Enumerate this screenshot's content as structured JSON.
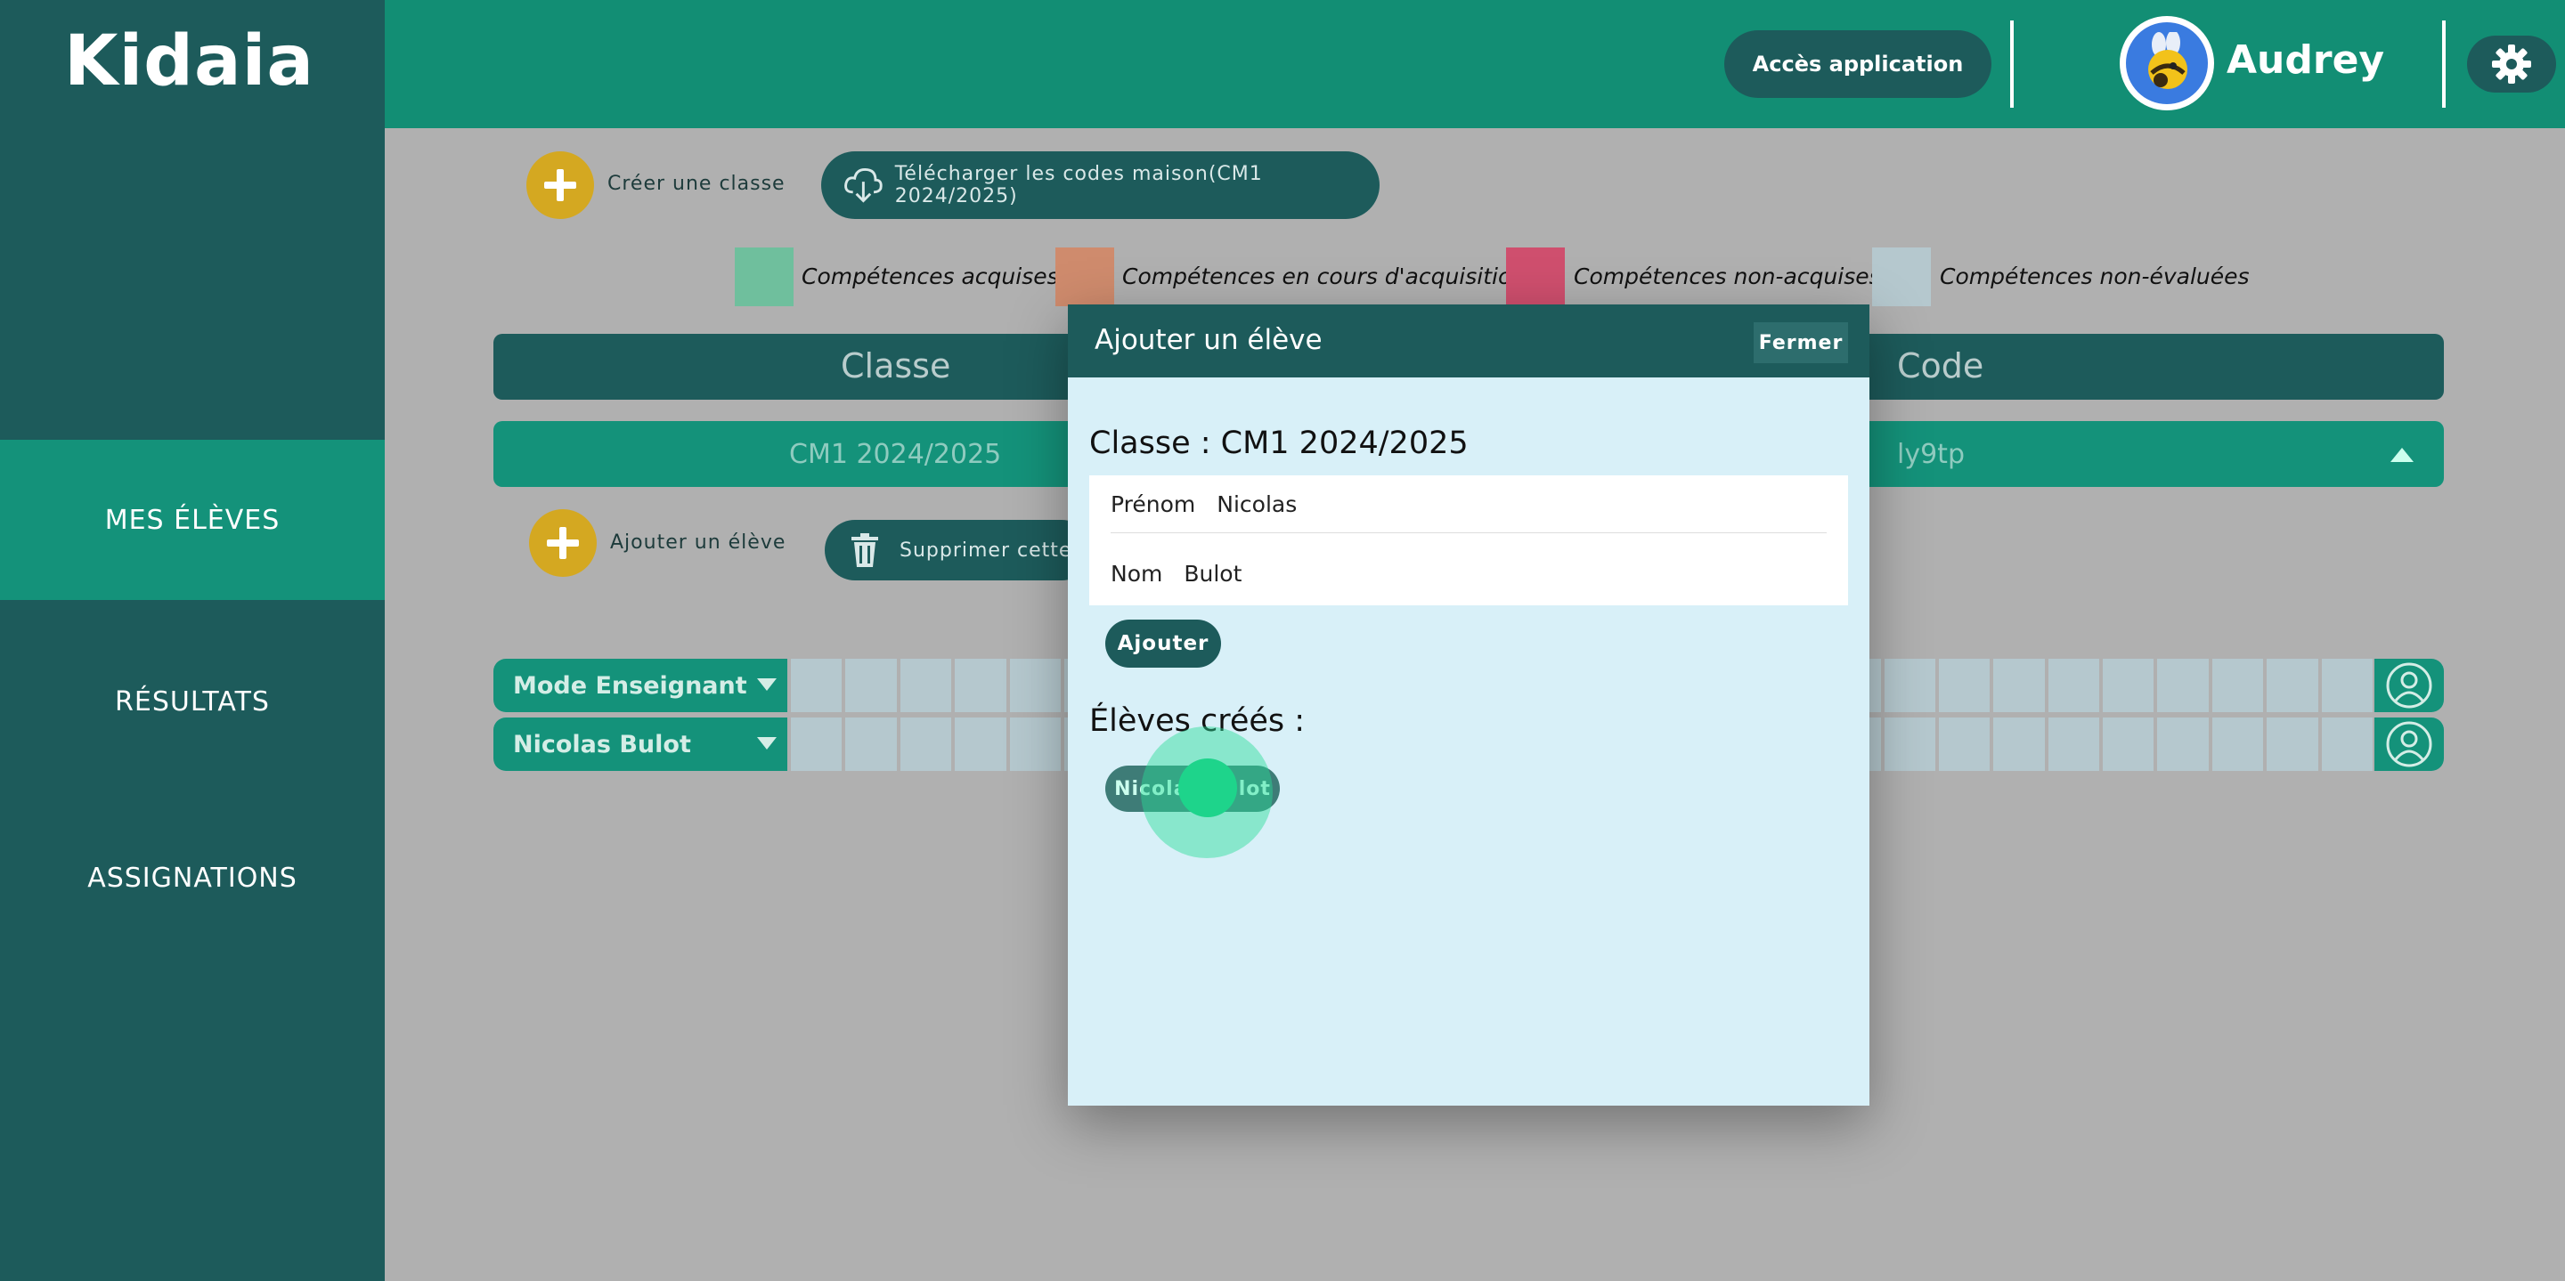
{
  "app": {
    "logo": "Kidaia"
  },
  "sidebar": {
    "items": [
      {
        "label": "MES ÉLÈVES",
        "active": true
      },
      {
        "label": "RÉSULTATS",
        "active": false
      },
      {
        "label": "ASSIGNATIONS",
        "active": false
      }
    ]
  },
  "header": {
    "app_access_label": "Accès application",
    "username": "Audrey",
    "avatar_icon": "bee-avatar-icon",
    "settings_icon": "gear-icon"
  },
  "toolbar": {
    "create_class_label": "Créer une classe",
    "download_codes_label": "Télécharger les codes maison(CM1 2024/2025)"
  },
  "legend": [
    {
      "label": "Compétences acquises",
      "color": "#6fbf9d"
    },
    {
      "label": "Compétences en cours d'acquisition",
      "color": "#cf8b6d"
    },
    {
      "label": "Compétences non-acquises",
      "color": "#cf4f6e"
    },
    {
      "label": "Compétences non-évaluées",
      "color": "#b5c8ce"
    }
  ],
  "table": {
    "col_class": "Classe",
    "col_code": "Code",
    "class_name": "CM1 2024/2025",
    "class_code": "ly9tp"
  },
  "class_actions": {
    "add_student_label": "Ajouter un élève",
    "delete_label": "Supprimer cette"
  },
  "students": [
    {
      "name": "Mode Enseignant"
    },
    {
      "name": "Nicolas Bulot"
    }
  ],
  "modal": {
    "title": "Ajouter un élève",
    "close_label": "Fermer",
    "class_line": "Classe : CM1 2024/2025",
    "first_name_label": "Prénom",
    "first_name_value": "Nicolas",
    "last_name_label": "Nom",
    "last_name_value": "Bulot",
    "add_label": "Ajouter",
    "created_title": "Élèves créés :",
    "created_chip": "Nicolas Bulot"
  }
}
